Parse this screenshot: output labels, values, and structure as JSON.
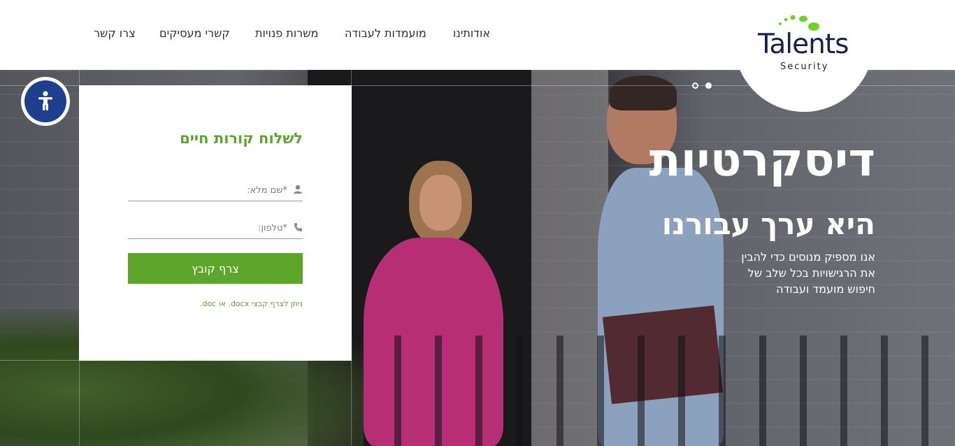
{
  "header": {
    "nav": [
      {
        "key": "about",
        "label": "אודותינו"
      },
      {
        "key": "candidates",
        "label": "מועמדות לעבודה"
      },
      {
        "key": "jobs",
        "label": "משרות פנויות"
      },
      {
        "key": "employers",
        "label": "קשרי מעסיקים"
      },
      {
        "key": "contact",
        "label": "צרו קשר"
      }
    ],
    "logo": {
      "name": "Talents",
      "tagline": "Security",
      "dot_color": "#6fd12a",
      "text_color": "#1b1f4d"
    }
  },
  "hero": {
    "title": "דיסקרטיות",
    "subtitle": "היא ערך עבורנו",
    "description": [
      "אנו מספיק מנוסים כדי להבין",
      "את הרגישויות בכל שלב של",
      "חיפוש מועמד ועבודה"
    ],
    "slides": 2
  },
  "form": {
    "title": "לשלוח קורות חיים",
    "name_placeholder": "*שם מלא:",
    "phone_placeholder": "*טלפון:",
    "attach_label": "צרף קובץ",
    "note": "ניתן לצרף קבצי docx. או doc.",
    "accent_color": "#5da62b"
  },
  "accessibility": {
    "icon": "accessibility-icon",
    "color": "#1d3f8e"
  }
}
